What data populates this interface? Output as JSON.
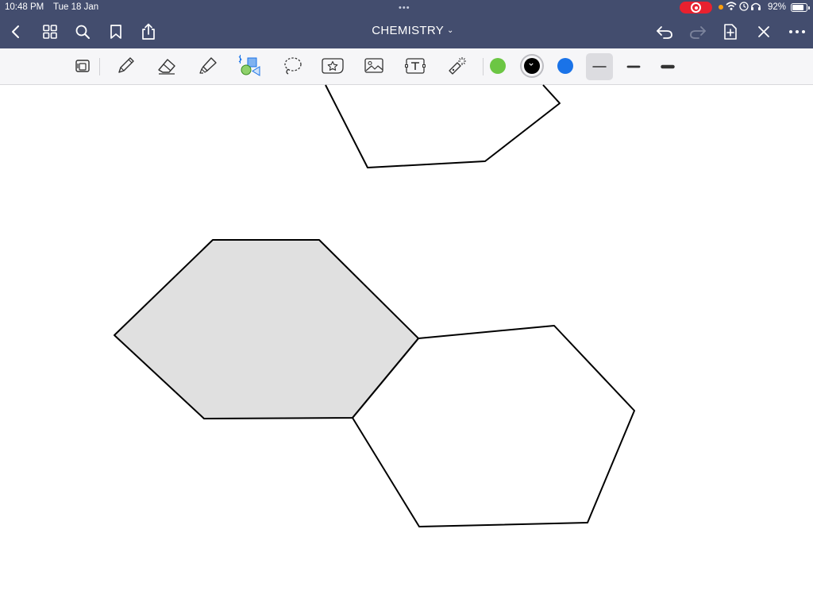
{
  "status_bar": {
    "time": "10:48 PM",
    "date": "Tue 18 Jan",
    "battery_percent": "92%",
    "battery_level": 0.92,
    "recording_color": "#e8212f"
  },
  "header": {
    "title": "CHEMISTRY",
    "left_icons": [
      "back-chevron-icon",
      "grid-view-icon",
      "search-icon",
      "bookmark-icon",
      "share-icon"
    ],
    "right_icons": [
      "undo-icon",
      "redo-icon",
      "add-page-icon",
      "close-icon",
      "more-icon"
    ],
    "redo_enabled": false,
    "background_color": "#434d6e"
  },
  "toolbar": {
    "tools": [
      "page-view-icon",
      "pen-icon",
      "eraser-icon",
      "highlighter-icon",
      "shapes-icon",
      "lasso-icon",
      "sticker-icon",
      "image-icon",
      "text-icon",
      "laser-pointer-icon"
    ],
    "colors": [
      {
        "name": "green",
        "hex": "#6cc644",
        "selected": false
      },
      {
        "name": "black",
        "hex": "#000000",
        "selected": true
      },
      {
        "name": "blue",
        "hex": "#1a73e8",
        "selected": false
      }
    ],
    "thickness_options": [
      "thin",
      "medium",
      "thick"
    ],
    "selected_thickness": "thin"
  },
  "canvas": {
    "shapes": [
      "partial-hexagon-top",
      "hexagon-shaded",
      "hexagon-right"
    ],
    "shaded_fill": "#e0e0e0",
    "stroke_color": "#000000"
  }
}
